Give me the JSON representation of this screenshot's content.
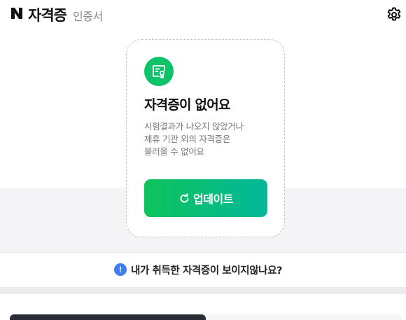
{
  "header": {
    "title": "자격증",
    "subtitle": "인증서"
  },
  "card": {
    "title": "자격증이 없어요",
    "description_lines": [
      "시험결과가 나오지 않았거나",
      "제휴 기관 외의 자격증은",
      "불러올 수 없어요"
    ],
    "update_label": "업데이트"
  },
  "help": {
    "icon_glyph": "!",
    "text": "내가 취득한 자격증이 보이지않나요?"
  },
  "colors": {
    "brand_green": "#0ec26a",
    "button_gradient_start": "#0ec35b",
    "button_gradient_end": "#03b89a",
    "info_blue": "#3d7df2"
  },
  "icons": {
    "logo": "naver-n-logo",
    "settings": "gear-icon",
    "certificate": "certificate-icon",
    "refresh": "refresh-icon",
    "info": "info-icon"
  }
}
